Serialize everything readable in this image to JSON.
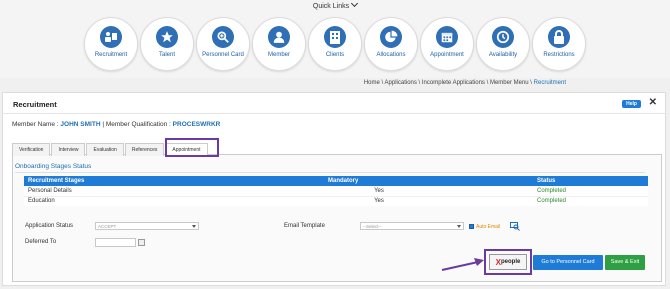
{
  "quick_links": {
    "title": "Quick Links",
    "items": [
      {
        "label": "Recruitment",
        "icon": "recruitment-icon"
      },
      {
        "label": "Talent",
        "icon": "star-icon"
      },
      {
        "label": "Personnel Card",
        "icon": "search-plus-icon"
      },
      {
        "label": "Member",
        "icon": "user-icon"
      },
      {
        "label": "Clients",
        "icon": "building-icon"
      },
      {
        "label": "Allocations",
        "icon": "pie-chart-icon"
      },
      {
        "label": "Appointment",
        "icon": "calendar-icon"
      },
      {
        "label": "Availability",
        "icon": "clock-icon"
      },
      {
        "label": "Restrictions",
        "icon": "lock-icon"
      }
    ]
  },
  "breadcrumb": {
    "home": "Home",
    "applications": "Applications",
    "incomplete": "Incomplete Applications",
    "member_menu": "Member Menu",
    "current": "Recruitment"
  },
  "panel": {
    "title": "Recruitment",
    "help_label": "Help",
    "close_label": "✕"
  },
  "member": {
    "name_label": "Member Name :",
    "name": "JOHN SMITH",
    "qual_label": "| Member Qualification :",
    "qualification": "PROCESWRKR"
  },
  "tabs": [
    "Verification",
    "Interview",
    "Evaluation",
    "References",
    "Appointment"
  ],
  "active_tab": "Appointment",
  "onboarding": {
    "title": "Onboarding Stages Status",
    "headers": [
      "Recruitment Stages",
      "Mandatory",
      "Status"
    ],
    "rows": [
      {
        "stage": "Personal Details",
        "mandatory": "Yes",
        "status": "Completed"
      },
      {
        "stage": "Education",
        "mandatory": "Yes",
        "status": "Completed"
      }
    ]
  },
  "form": {
    "application_status_label": "Application Status",
    "application_status_value": "ACCEPT",
    "deferred_to_label": "Deferred To",
    "email_template_label": "Email Template",
    "email_template_value": "--Select--",
    "auto_email_label": "Auto Email"
  },
  "buttons": {
    "xpeople_x": "X",
    "xpeople_rest": "people",
    "personnel_card": "Go to Personnel Card",
    "save_exit": "Save & Exit"
  },
  "colors": {
    "accent": "#1f7cd6",
    "success": "#2ea043",
    "highlight": "#6a3aa2"
  }
}
